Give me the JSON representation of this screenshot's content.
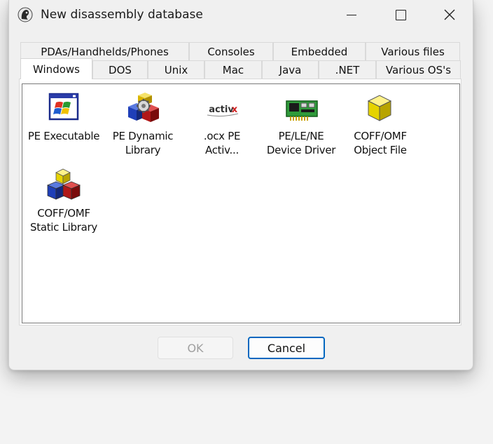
{
  "window": {
    "title": "New disassembly database",
    "controls": [
      "minimize",
      "maximize",
      "close"
    ]
  },
  "tabs": {
    "back_row": [
      {
        "label": "PDAs/Handhelds/Phones"
      },
      {
        "label": "Consoles"
      },
      {
        "label": "Embedded"
      },
      {
        "label": "Various files"
      }
    ],
    "front_row": [
      {
        "label": "Windows",
        "active": true
      },
      {
        "label": "DOS"
      },
      {
        "label": "Unix"
      },
      {
        "label": "Mac"
      },
      {
        "label": "Java"
      },
      {
        "label": ".NET"
      },
      {
        "label": "Various OS's"
      }
    ]
  },
  "items": [
    {
      "label": "PE Executable",
      "icon": "windows-exe-icon"
    },
    {
      "label": "PE Dynamic\nLibrary",
      "icon": "gear-blocks-icon"
    },
    {
      "label": ".ocx PE\nActiv...",
      "icon": "activex-icon"
    },
    {
      "label": "PE/LE/NE\nDevice Driver",
      "icon": "circuit-board-icon"
    },
    {
      "label": "COFF/OMF\nObject File",
      "icon": "yellow-cube-icon"
    },
    {
      "label": "COFF/OMF\nStatic Library",
      "icon": "stacked-cubes-icon"
    }
  ],
  "buttons": {
    "ok": {
      "label": "OK",
      "enabled": false
    },
    "cancel": {
      "label": "Cancel",
      "enabled": true
    }
  }
}
